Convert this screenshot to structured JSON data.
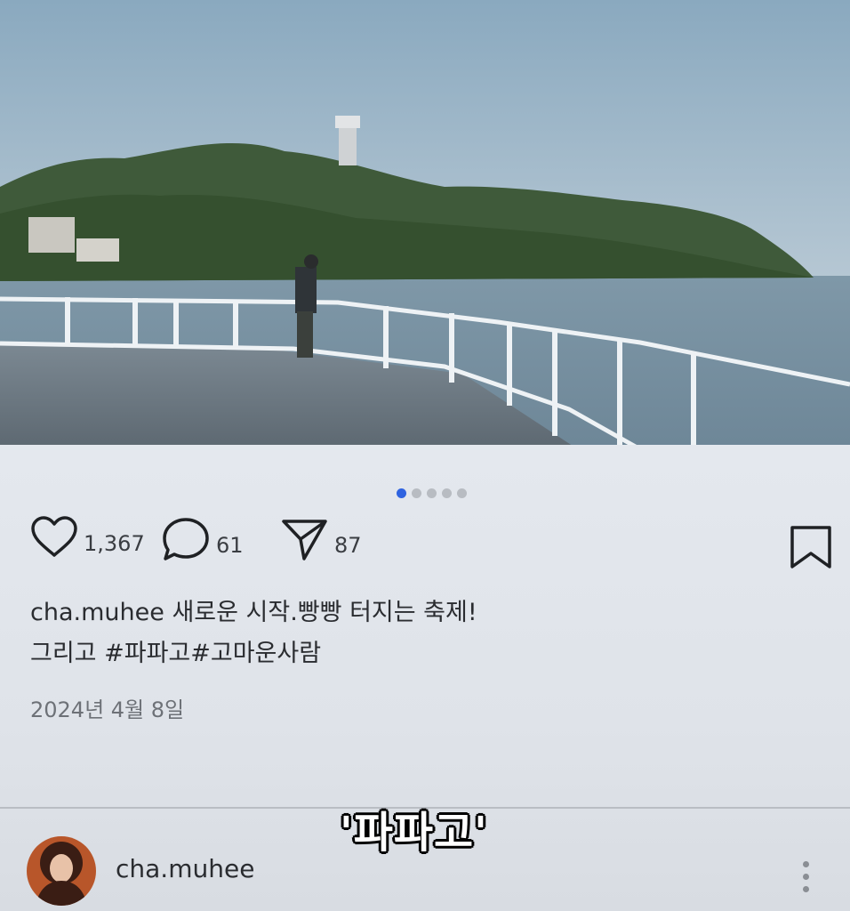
{
  "post": {
    "likes": "1,367",
    "comments": "61",
    "shares": "87",
    "carousel": {
      "total": 5,
      "active": 1
    },
    "caption_user": "cha.muhee",
    "caption_line1": "새로운 시작.빵빵 터지는 축제!",
    "caption_line2": "그리고 #파파고#고마운사람",
    "date": "2024년 4월 8일"
  },
  "subtitle": "'파파고'",
  "footer": {
    "username": "cha.muhee"
  },
  "colors": {
    "active_dot": "#2f63e0",
    "card_bg": "#e2e6ec",
    "text": "#2a2c30"
  },
  "icons": [
    "heart-icon",
    "comment-icon",
    "send-icon",
    "bookmark-icon",
    "more-icon"
  ]
}
